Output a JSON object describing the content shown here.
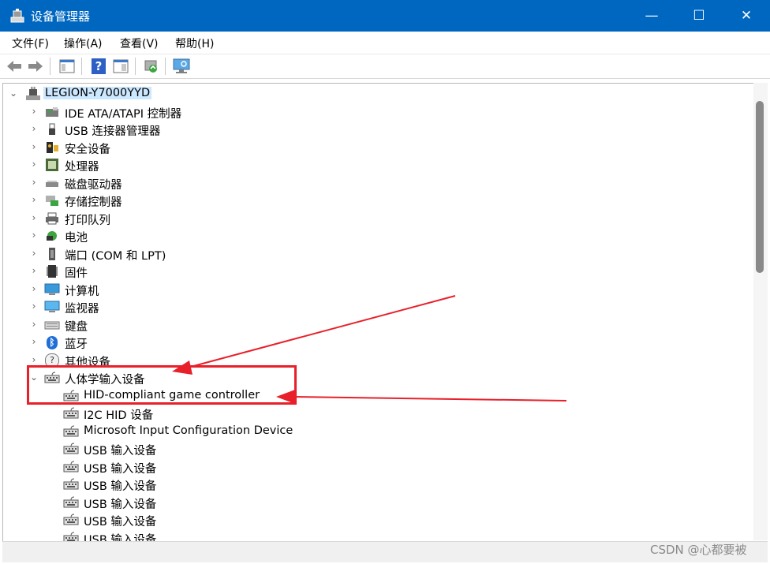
{
  "window": {
    "title": "设备管理器",
    "minimize": "—",
    "maximize": "☐",
    "close": "✕"
  },
  "menu": [
    {
      "label": "文件(F)"
    },
    {
      "label": "操作(A)"
    },
    {
      "label": "查看(V)"
    },
    {
      "label": "帮助(H)"
    }
  ],
  "toolbar": {
    "help_glyph": "?"
  },
  "tree": {
    "root": "LEGION-Y7000YYD",
    "categories": [
      {
        "label": "IDE ATA/ATAPI 控制器",
        "icon": "ide-controller-icon"
      },
      {
        "label": "USB 连接器管理器",
        "icon": "usb-connector-icon"
      },
      {
        "label": "安全设备",
        "icon": "security-device-icon"
      },
      {
        "label": "处理器",
        "icon": "processor-icon"
      },
      {
        "label": "磁盘驱动器",
        "icon": "disk-drive-icon"
      },
      {
        "label": "存储控制器",
        "icon": "storage-controller-icon"
      },
      {
        "label": "打印队列",
        "icon": "printer-icon"
      },
      {
        "label": "电池",
        "icon": "battery-icon"
      },
      {
        "label": "端口 (COM 和 LPT)",
        "icon": "port-icon"
      },
      {
        "label": "固件",
        "icon": "firmware-icon"
      },
      {
        "label": "计算机",
        "icon": "computer-icon"
      },
      {
        "label": "监视器",
        "icon": "monitor-icon"
      },
      {
        "label": "键盘",
        "icon": "keyboard-icon"
      },
      {
        "label": "蓝牙",
        "icon": "bluetooth-icon",
        "glyph": "ᛒ"
      },
      {
        "label": "其他设备",
        "icon": "other-devices-icon",
        "glyph": "?"
      }
    ],
    "expanded": {
      "label": "人体学输入设备",
      "children": [
        {
          "label": "HID-compliant game controller"
        },
        {
          "label": "I2C HID 设备"
        },
        {
          "label": "Microsoft Input Configuration Device"
        },
        {
          "label": "USB 输入设备"
        },
        {
          "label": "USB 输入设备"
        },
        {
          "label": "USB 输入设备"
        },
        {
          "label": "USB 输入设备"
        },
        {
          "label": "USB 输入设备"
        },
        {
          "label": "USB 输入设备"
        }
      ]
    }
  },
  "chevrons": {
    "collapsed": "›",
    "expanded": "⌄"
  },
  "watermark": "CSDN @心都要被",
  "colors": {
    "titlebar": "#0067c0",
    "annotation": "#e8202a",
    "selection": "#cce8ff"
  }
}
